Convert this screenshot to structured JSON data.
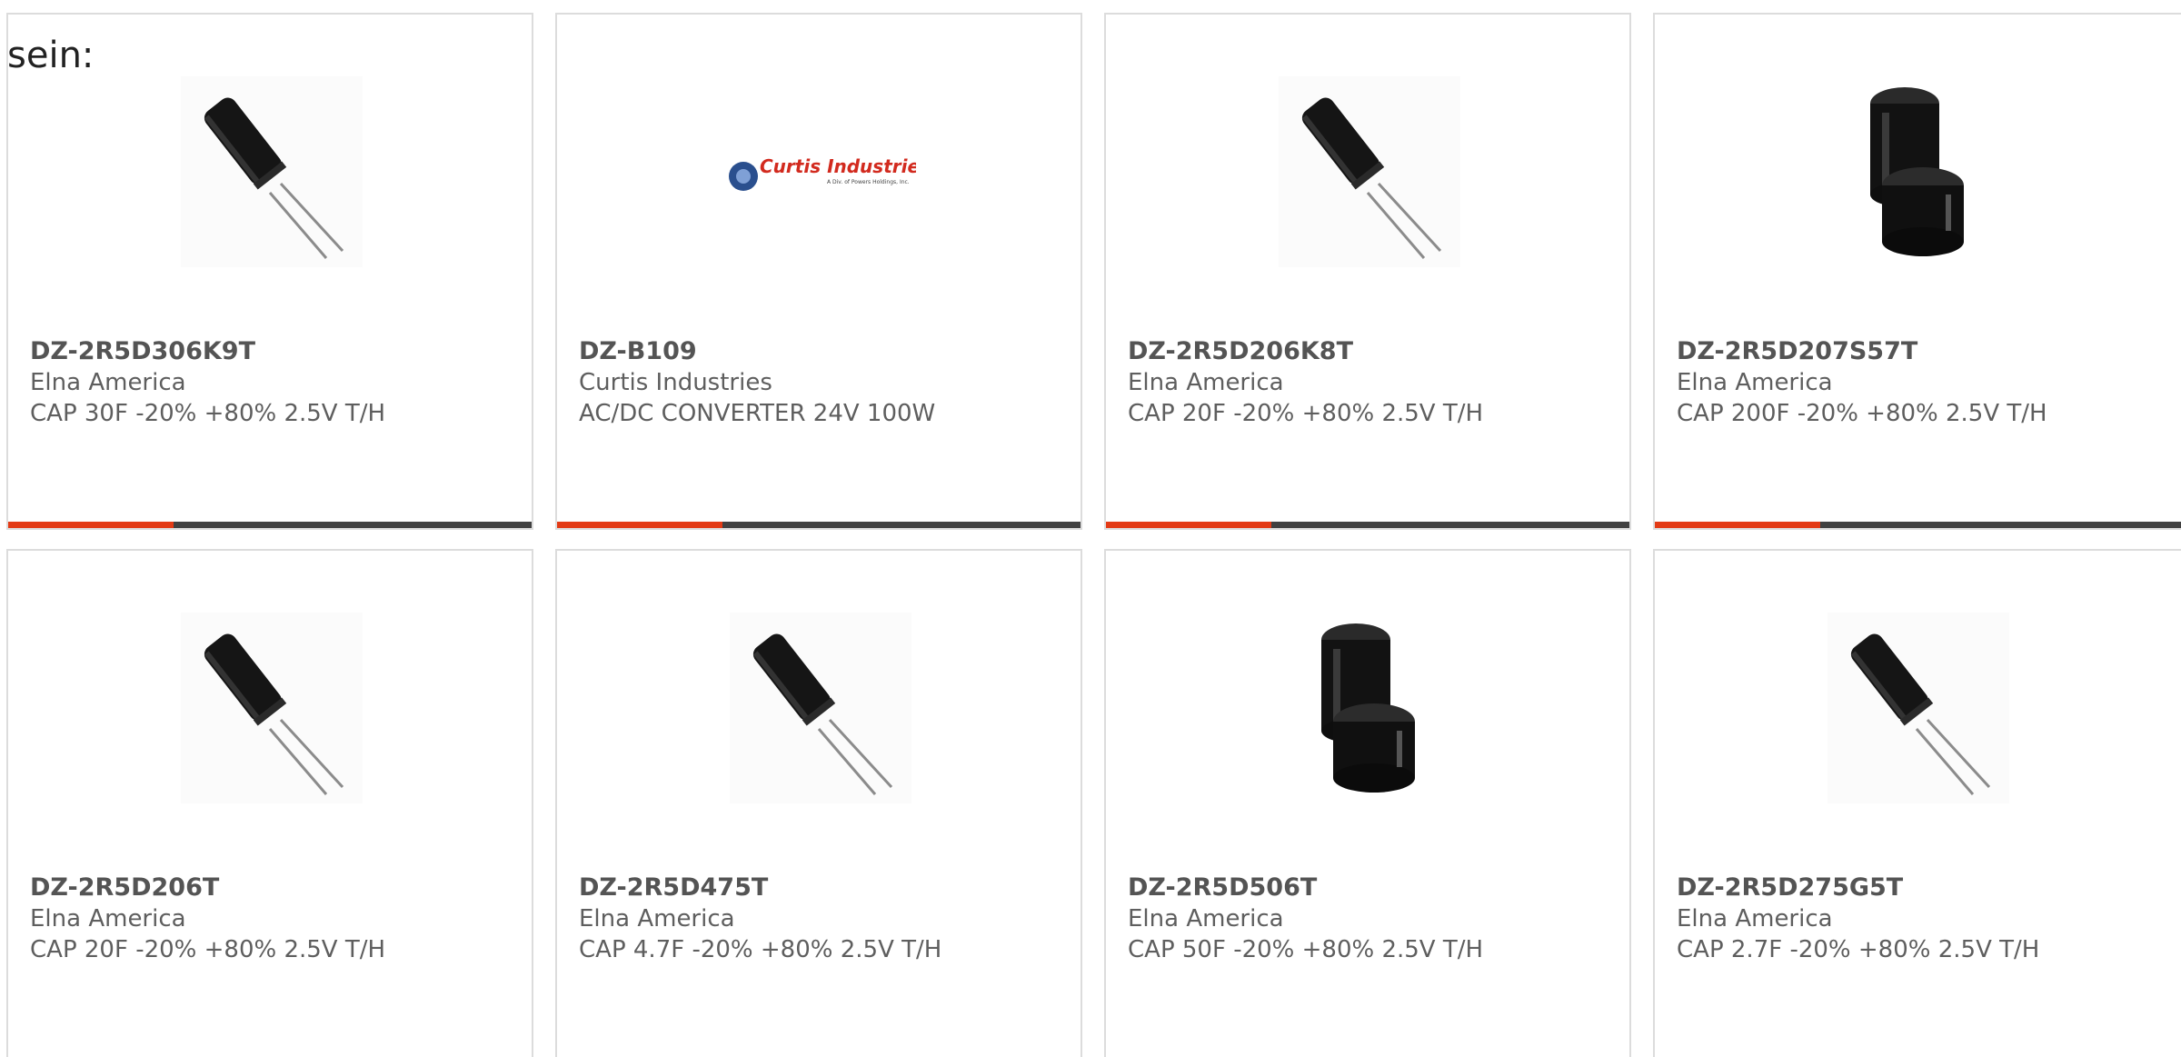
{
  "intro_text": "sein:",
  "colors": {
    "accent": "#e33b16",
    "bar": "#414141",
    "border": "#dcdcdc"
  },
  "products": [
    {
      "part_number": "DZ-2R5D306K9T",
      "manufacturer": "Elna America",
      "description": "CAP 30F -20% +80% 2.5V T/H",
      "image": "thin-capacitor-icon"
    },
    {
      "part_number": "DZ-B109",
      "manufacturer": "Curtis Industries",
      "description": "AC/DC CONVERTER 24V 100W",
      "image": "curtis-industries-logo",
      "logo_title": "Curtis Industries",
      "logo_subtitle": "A Div. of Powers Holdings, Inc."
    },
    {
      "part_number": "DZ-2R5D206K8T",
      "manufacturer": "Elna America",
      "description": "CAP 20F -20% +80% 2.5V T/H",
      "image": "thin-capacitor-icon"
    },
    {
      "part_number": "DZ-2R5D207S57T",
      "manufacturer": "Elna America",
      "description": "CAP 200F -20% +80% 2.5V T/H",
      "image": "large-capacitor-pair-icon"
    },
    {
      "part_number": "DZ-2R5D206T",
      "manufacturer": "Elna America",
      "description": "CAP 20F -20% +80% 2.5V T/H",
      "image": "thin-capacitor-icon"
    },
    {
      "part_number": "DZ-2R5D475T",
      "manufacturer": "Elna America",
      "description": "CAP 4.7F -20% +80% 2.5V T/H",
      "image": "thin-capacitor-icon"
    },
    {
      "part_number": "DZ-2R5D506T",
      "manufacturer": "Elna America",
      "description": "CAP 50F -20% +80% 2.5V T/H",
      "image": "large-capacitor-pair-icon"
    },
    {
      "part_number": "DZ-2R5D275G5T",
      "manufacturer": "Elna America",
      "description": "CAP 2.7F -20% +80% 2.5V T/H",
      "image": "thin-capacitor-icon"
    }
  ]
}
